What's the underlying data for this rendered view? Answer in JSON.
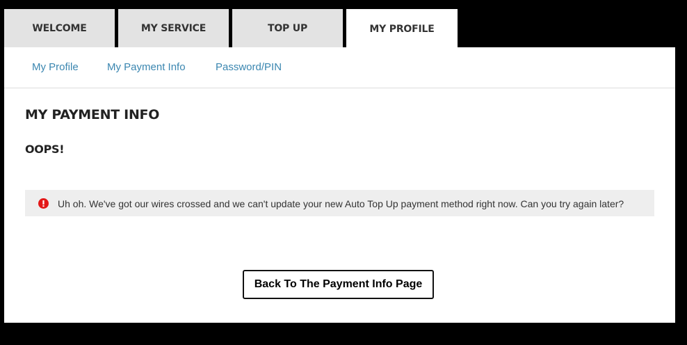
{
  "tabs": [
    {
      "label": "WELCOME",
      "active": false
    },
    {
      "label": "MY SERVICE",
      "active": false
    },
    {
      "label": "TOP UP",
      "active": false
    },
    {
      "label": "MY PROFILE",
      "active": true
    }
  ],
  "subnav": {
    "items": [
      "My Profile",
      "My Payment Info",
      "Password/PIN"
    ]
  },
  "main": {
    "title": "MY PAYMENT INFO",
    "oops": "OOPS!",
    "alert": {
      "icon": "error-icon",
      "text": "Uh oh. We've got our wires crossed and we can't update your new Auto Top Up payment method right now. Can you try again later?"
    },
    "back_button_label": "Back To The Payment Info Page"
  },
  "colors": {
    "page_background": "#000000",
    "tab_inactive": "#e3e3e3",
    "tab_active": "#ffffff",
    "link": "#3a86b0",
    "alert_background": "#eeeeee",
    "error_icon": "#e31818"
  }
}
